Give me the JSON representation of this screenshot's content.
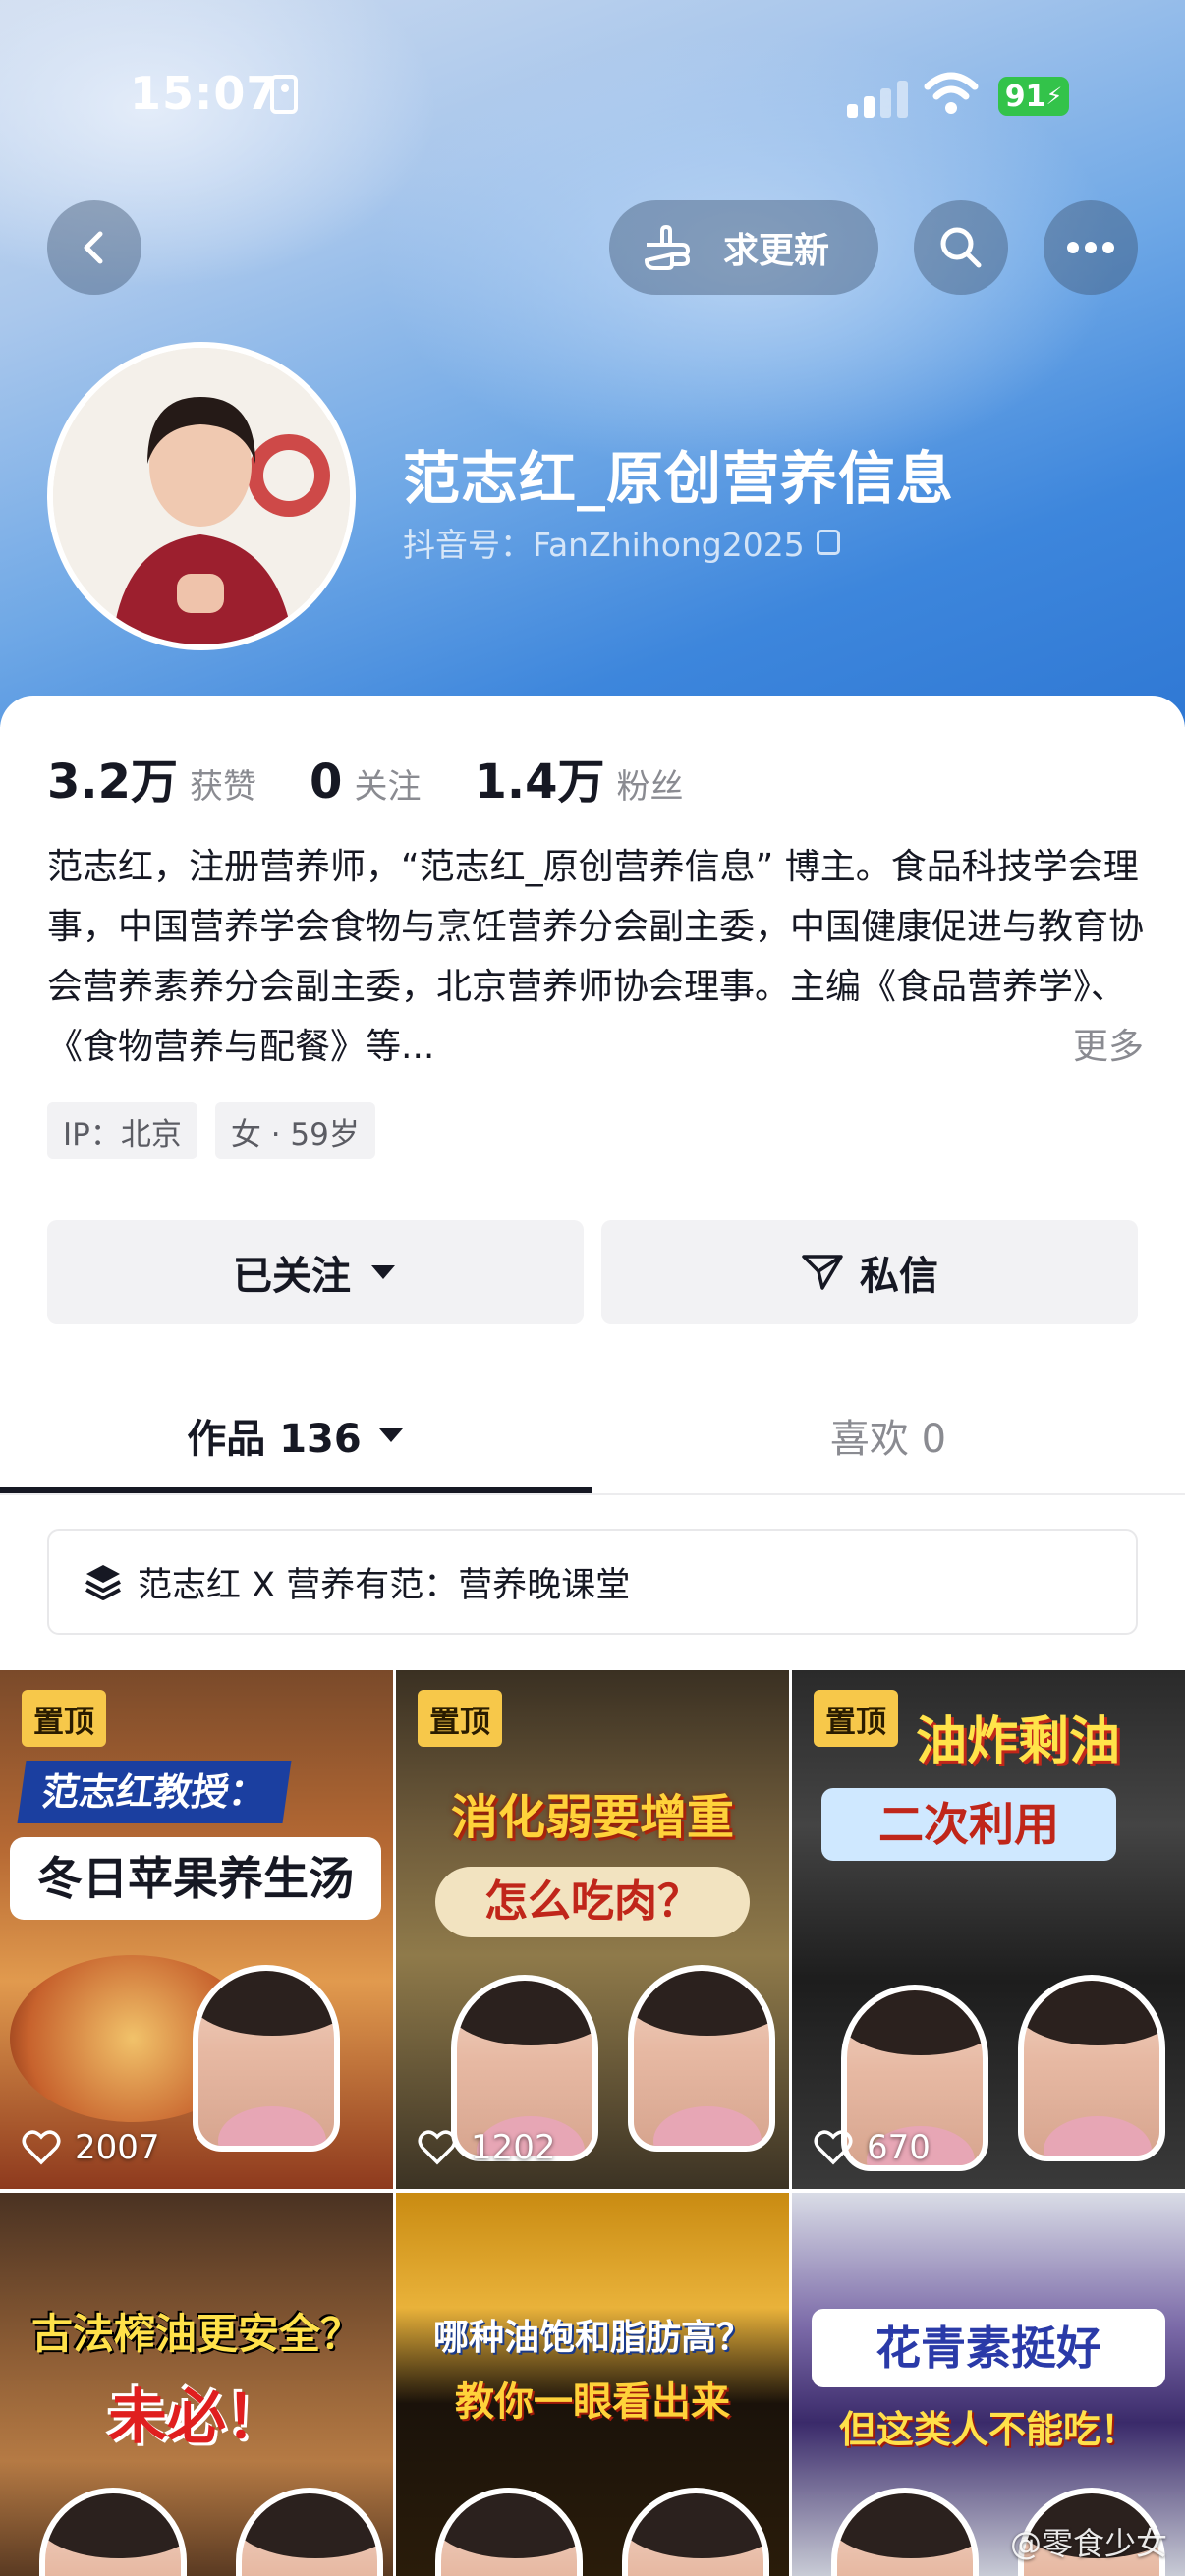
{
  "status_bar": {
    "time": "15:07",
    "battery": "91"
  },
  "header": {
    "request_update_label": "求更新",
    "name": "范志红_原创营养信息",
    "douyin_id": "抖音号：FanZhihong2025"
  },
  "stats": [
    {
      "value": "3.2万",
      "label": "获赞"
    },
    {
      "value": "0",
      "label": "关注"
    },
    {
      "value": "1.4万",
      "label": "粉丝"
    }
  ],
  "bio": {
    "text": "范志红，注册营养师，“范志红_原创营养信息” 博主。食品科技学会理事，中国营养学会食物与烹饪营养分会副主委，中国健康促进与教育协会营养素养分会副主委，北京营养师协会理事。主编《食品营养学》、《食物营养与配餐》等...",
    "more": "更多"
  },
  "tags": [
    "IP：北京",
    "女 · 59岁"
  ],
  "actions": {
    "follow": "已关注",
    "message": "私信"
  },
  "tabs": {
    "works": "作品 136",
    "likes": "喜欢 0"
  },
  "collection": "范志红 X 营养有范：营养晚课堂",
  "pinned_label": "置顶",
  "videos": [
    {
      "cap1": "范志红教授：",
      "cap2": "冬日苹果养生汤",
      "likes": "2007"
    },
    {
      "cap1": "消化弱要增重",
      "cap2": "怎么吃肉？",
      "likes": "1202"
    },
    {
      "cap1": "油炸剩油",
      "cap2": "二次利用",
      "likes": "670"
    },
    {
      "cap1": "古法榨油更安全？",
      "cap2": "未必！"
    },
    {
      "cap1": "哪种油饱和脂肪高？",
      "cap2": "教你一眼看出来"
    },
    {
      "cap1": "花青素挺好",
      "cap2": "但这类人不能吃！"
    }
  ],
  "watermark": "@零食少女"
}
